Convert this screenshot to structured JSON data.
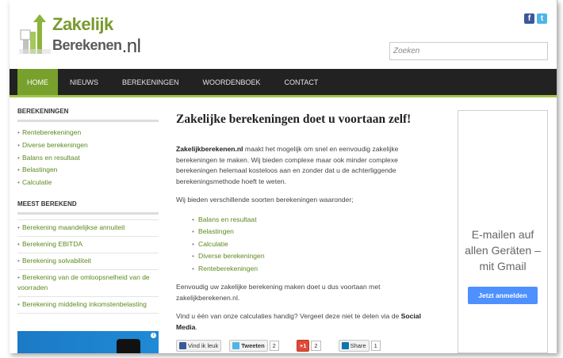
{
  "header": {
    "logo_line1": "Zakelijk",
    "logo_line2": "Berekenen",
    "logo_tld": ".nl",
    "search_placeholder": "Zoeken",
    "social": [
      {
        "icon": "facebook-icon",
        "glyph": "f"
      },
      {
        "icon": "twitter-icon",
        "glyph": "t"
      }
    ]
  },
  "nav": {
    "items": [
      "HOME",
      "NIEUWS",
      "BEREKENINGEN",
      "WOORDENBOEK",
      "CONTACT"
    ],
    "active_index": 0
  },
  "sidebar": {
    "section1_title": "BEREKENINGEN",
    "section1_items": [
      "Renteberekeningen",
      "Diverse berekeningen",
      "Balans en resultaat",
      "Belastingen",
      "Calculatie"
    ],
    "section2_title": "MEEST BEREKEND",
    "section2_items": [
      "Berekening maandelijkse annuiteit",
      "Berekening EBITDA",
      "Berekening solvabiliteit",
      "Berekening van de omloopsnelheid van de voorraden",
      "Berekening middeling inkomstenbelasting"
    ]
  },
  "main": {
    "title": "Zakelijke berekeningen doet u voortaan zelf!",
    "intro_bold": "Zakelijkberekenen.nl",
    "intro_rest": " maakt het mogelijk om snel en eenvoudig zakelijke berekeningen te maken. Wij bieden complexe maar ook minder complexe berekeningen helemaal kosteloos aan en zonder dat u de achterliggende berekeningsmethode hoeft te weten.",
    "para2": "Wij bieden verschillende soorten berekeningen waaronder;",
    "list": [
      "Balans en resultaat",
      "Belastingen",
      "Calculatie",
      "Diverse berekeningen",
      "Renteberekeningen"
    ],
    "para3": "Eenvoudig uw zakelijke berekening maken doet u dus voortaan met zakelijkberekenen.nl.",
    "para4_pre": "Vind u één van onze calculaties handig? Vergeet deze niet te delen via de ",
    "para4_bold": "Social Media",
    "para4_post": "."
  },
  "share": {
    "fb_label": "Vind ik leuk",
    "tw_label": "Tweeten",
    "tw_count": "2",
    "gplus_label": "+1",
    "gplus_count": "2",
    "li_label": "Share",
    "li_count": "1"
  },
  "ad": {
    "text": "E-mailen auf allen Geräten – mit Gmail",
    "button": "Jetzt anmelden"
  },
  "colors": {
    "accent_green": "#78a02c",
    "link_green": "#5c8a1f",
    "nav_bg": "#222222",
    "gmail_blue": "#4d90fe"
  }
}
